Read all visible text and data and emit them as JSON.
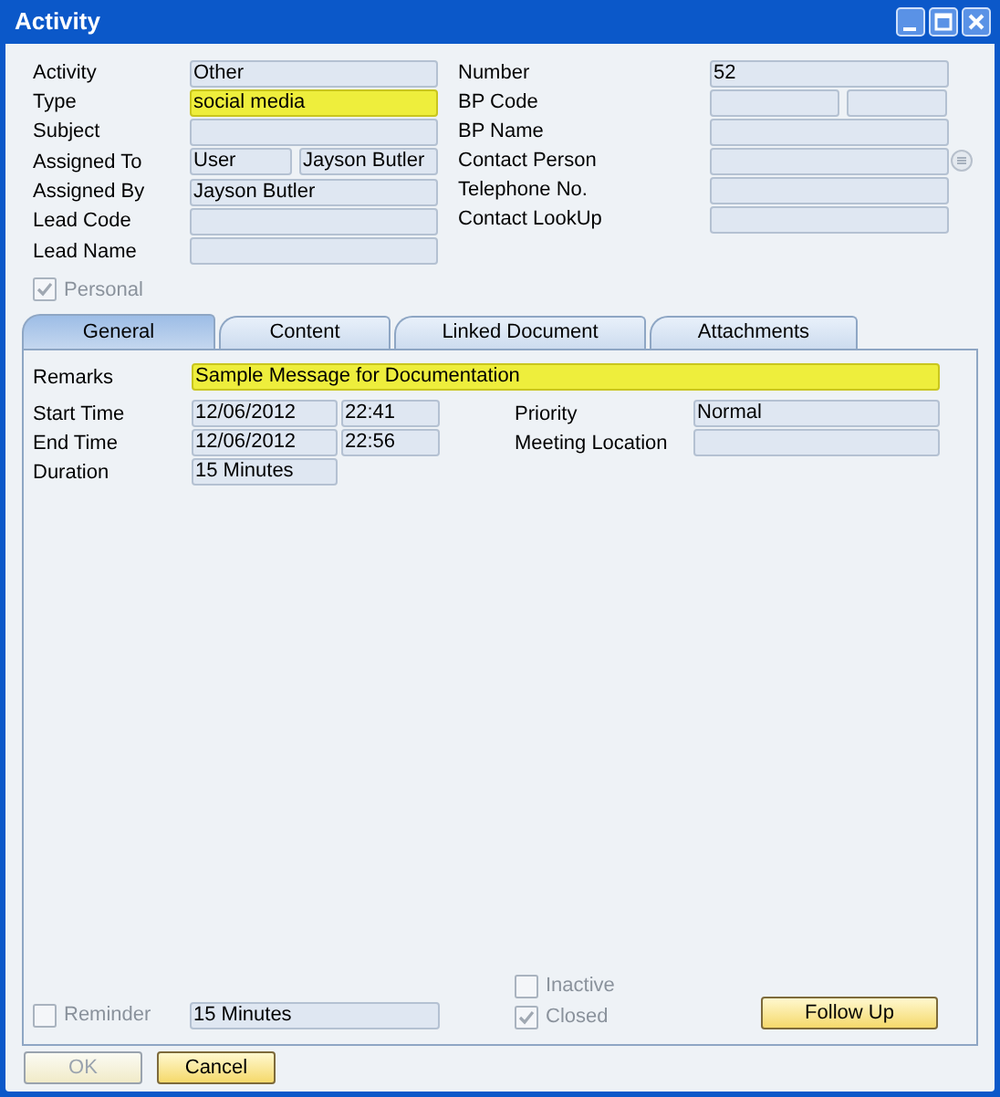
{
  "window": {
    "title": "Activity"
  },
  "header_left": [
    {
      "label": "Activity",
      "fields": [
        {
          "value": "Other",
          "highlighted": false
        }
      ]
    },
    {
      "label": "Type",
      "fields": [
        {
          "value": "social media",
          "highlighted": true
        }
      ]
    },
    {
      "label": "Subject",
      "fields": [
        {
          "highlighted": false
        }
      ]
    },
    {
      "label": "Assigned To",
      "fields": [
        {
          "value": "User",
          "highlighted": false
        },
        {
          "value": "Jayson Butler",
          "highlighted": false
        }
      ]
    },
    {
      "label": "Assigned By",
      "fields": [
        {
          "value": "Jayson Butler",
          "highlighted": false
        }
      ]
    },
    {
      "label": "Lead Code",
      "fields": [
        {
          "highlighted": false
        }
      ]
    },
    {
      "label": "Lead Name",
      "fields": [
        {
          "highlighted": false
        }
      ]
    }
  ],
  "header_right": [
    {
      "label": "Number",
      "kind": "text",
      "fields": [
        {
          "value": "52",
          "highlighted": false
        }
      ]
    },
    {
      "label": "BP Code",
      "kind": "text",
      "fields": [
        {
          "highlighted": false
        },
        {
          "highlighted": false
        }
      ]
    },
    {
      "label": "BP Name",
      "kind": "text",
      "fields": [
        {
          "highlighted": false
        }
      ]
    },
    {
      "label": "Contact Person",
      "kind": "lookup",
      "fields": [
        {
          "highlighted": false
        }
      ]
    },
    {
      "label": "Telephone No.",
      "kind": "text",
      "fields": [
        {
          "highlighted": false
        }
      ]
    },
    {
      "label": "Contact LookUp",
      "kind": "text",
      "fields": [
        {
          "highlighted": false
        }
      ]
    }
  ],
  "personal": {
    "label": "Personal",
    "checked": true,
    "disabled": true
  },
  "tabs": [
    {
      "label": "General",
      "selected": true
    },
    {
      "label": "Content",
      "selected": false
    },
    {
      "label": "Linked Document",
      "selected": false
    },
    {
      "label": "Attachments",
      "selected": false
    }
  ],
  "general": {
    "remarks": {
      "label": "Remarks",
      "value": "Sample Message for Documentation",
      "highlighted": true
    },
    "times": [
      {
        "label": "Start Time",
        "fields": [
          {
            "value": "12/06/2012",
            "highlighted": false
          },
          {
            "value": "22:41",
            "highlighted": false
          }
        ]
      },
      {
        "label": "End Time",
        "fields": [
          {
            "value": "12/06/2012",
            "highlighted": false
          },
          {
            "value": "22:56",
            "highlighted": false
          }
        ]
      },
      {
        "label": "Duration",
        "fields": [
          {
            "value": "15 Minutes",
            "highlighted": false
          }
        ]
      }
    ],
    "right": [
      {
        "label": "Priority",
        "fields": [
          {
            "value": "Normal",
            "highlighted": false
          }
        ]
      },
      {
        "label": "Meeting Location",
        "fields": [
          {
            "highlighted": false
          }
        ]
      }
    ],
    "reminder": {
      "label": "Reminder",
      "checked": false,
      "disabled": true,
      "value": "15 Minutes"
    },
    "inactive": {
      "label": "Inactive",
      "checked": false,
      "disabled": true
    },
    "closed": {
      "label": "Closed",
      "checked": true,
      "disabled": true
    },
    "follow_up": {
      "label": "Follow Up"
    }
  },
  "buttons": [
    {
      "label": "OK",
      "disabled": true
    },
    {
      "label": "Cancel",
      "disabled": false
    }
  ]
}
